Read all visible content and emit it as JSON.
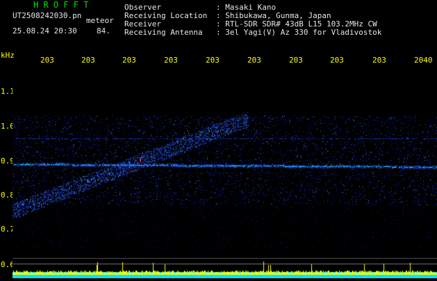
{
  "header": {
    "title": "H R O F F T",
    "filename": "UT2508242030.pn",
    "meteor_label": "meteor",
    "datetime": "25.08.24 20:30",
    "count": "84."
  },
  "info": {
    "observer_label": "Observer",
    "observer_value": ": Masaki Kano",
    "location_label": "Receiving Location",
    "location_value": ": Shibukawa, Gunma, Japan",
    "receiver_label": "Receiver",
    "receiver_value": ": RTL-SDR SDR# 43dB L15 103.2MHz CW",
    "antenna_label": "Receiving Antenna",
    "antenna_value": ": 3el Yagi(V) Az 330 for Vladivostok"
  },
  "axes": {
    "y_unit": "kHz",
    "y_ticks": [
      "1.1",
      "1.0",
      "0.9",
      "0.8",
      "0.7",
      "0.6"
    ],
    "x_ticks": [
      "203",
      "203",
      "203",
      "203",
      "203",
      "203",
      "203",
      "203",
      "203",
      "2040"
    ]
  },
  "colors": {
    "title": "#00e000",
    "axis_labels": "#ffff00",
    "text": "#e6e6e6",
    "signal_bar": "#00e5ff",
    "signal_peaks": "#ffff00"
  }
}
